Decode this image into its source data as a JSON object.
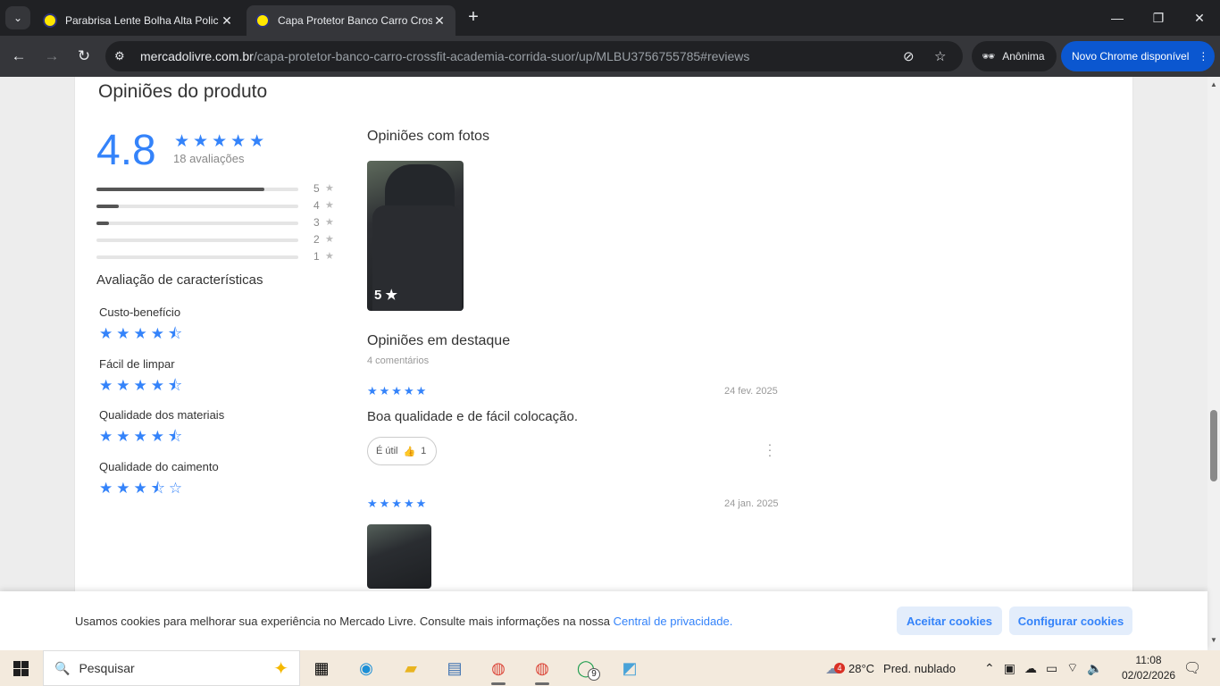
{
  "browser": {
    "tabs": [
      {
        "title": "Parabrisa Lente Bolha Alta Polic",
        "active": false
      },
      {
        "title": "Capa Protetor Banco Carro Cros",
        "active": true
      }
    ],
    "url_domain": "mercadolivre.com.br",
    "url_path": "/capa-protetor-banco-carro-crossfit-academia-corrida-suor/up/MLBU3756755785#reviews",
    "incognito_label": "Anônima",
    "update_label": "Novo Chrome disponível"
  },
  "reviews": {
    "title": "Opiniões do produto",
    "average": "4.8",
    "average_stars": "★★★★★",
    "count_label": "18 avaliações",
    "distribution": [
      {
        "stars": "5",
        "fraction": 0.83
      },
      {
        "stars": "4",
        "fraction": 0.11
      },
      {
        "stars": "3",
        "fraction": 0.06
      },
      {
        "stars": "2",
        "fraction": 0
      },
      {
        "stars": "1",
        "fraction": 0
      }
    ],
    "features_title": "Avaliação de características",
    "features": [
      {
        "label": "Custo-benefício",
        "stars": "★★★★⯪"
      },
      {
        "label": "Fácil de limpar",
        "stars": "★★★★⯪"
      },
      {
        "label": "Qualidade dos materiais",
        "stars": "★★★★⯪"
      },
      {
        "label": "Qualidade do caimento",
        "stars": "★★★⯪☆"
      }
    ],
    "photos_title": "Opiniões com fotos",
    "photo_badge": "5 ★",
    "featured_title": "Opiniões em destaque",
    "comments_label": "4 comentários",
    "items": [
      {
        "stars": "★★★★★",
        "date": "24 fev. 2025",
        "text": "Boa qualidade e de fácil colocação.",
        "useful_label": "É útil",
        "useful_count": "1"
      },
      {
        "stars": "★★★★★",
        "date": "24 jan. 2025"
      }
    ]
  },
  "cookie": {
    "message": "Usamos cookies para melhorar sua experiência no Mercado Livre. Consulte mais informações na nossa ",
    "link": "Central de privacidade.",
    "accept": "Aceitar cookies",
    "configure": "Configurar cookies"
  },
  "taskbar": {
    "search_placeholder": "Pesquisar",
    "weather_badge": "4",
    "temperature": "28°C",
    "weather": "Pred. nublado",
    "whatsapp_badge": "9",
    "time": "11:08",
    "date": "02/02/2026"
  },
  "colors": {
    "accent": "#3483fa",
    "chrome_dark": "#202124",
    "chrome_toolbar": "#35363a",
    "update_button": "#0b57d0"
  }
}
